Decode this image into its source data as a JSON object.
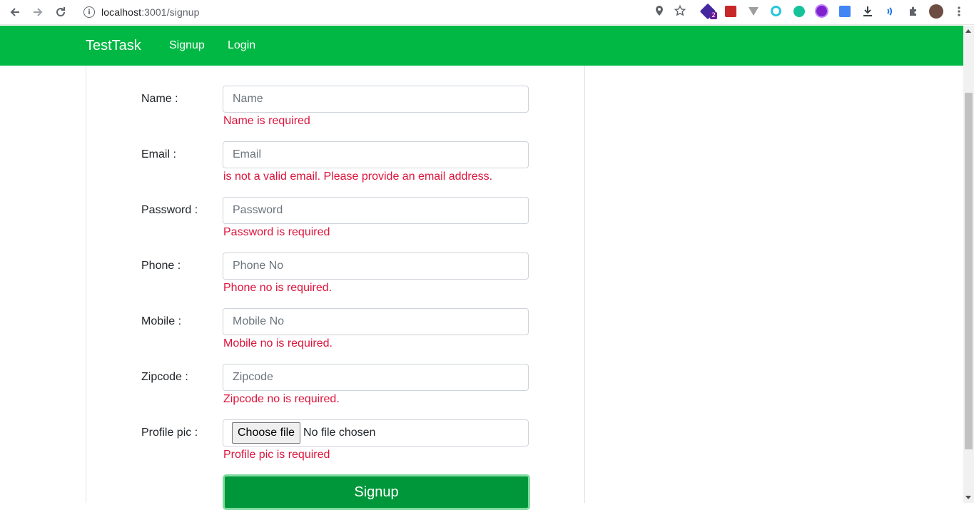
{
  "browser": {
    "url_host": "localhost",
    "url_path": ":3001/signup",
    "ext_badge": "2"
  },
  "navbar": {
    "brand": "TestTask",
    "links": [
      "Signup",
      "Login"
    ]
  },
  "form": {
    "fields": [
      {
        "label": "Name :",
        "placeholder": "Name",
        "error": "Name is required"
      },
      {
        "label": "Email :",
        "placeholder": "Email",
        "error": "is not a valid email. Please provide an email address."
      },
      {
        "label": "Password :",
        "placeholder": "Password",
        "error": "Password is required"
      },
      {
        "label": "Phone :",
        "placeholder": "Phone No",
        "error": "Phone no is required."
      },
      {
        "label": "Mobile :",
        "placeholder": "Mobile No",
        "error": "Mobile no is required."
      },
      {
        "label": "Zipcode :",
        "placeholder": "Zipcode",
        "error": "Zipcode no is required."
      }
    ],
    "profile": {
      "label": "Profile pic :",
      "button": "Choose file",
      "file_status": "No file chosen",
      "error": "Profile pic is required"
    },
    "submit_label": "Signup"
  },
  "colors": {
    "navbar": "#00b843",
    "error": "#dc143c",
    "submit": "#00963a"
  }
}
